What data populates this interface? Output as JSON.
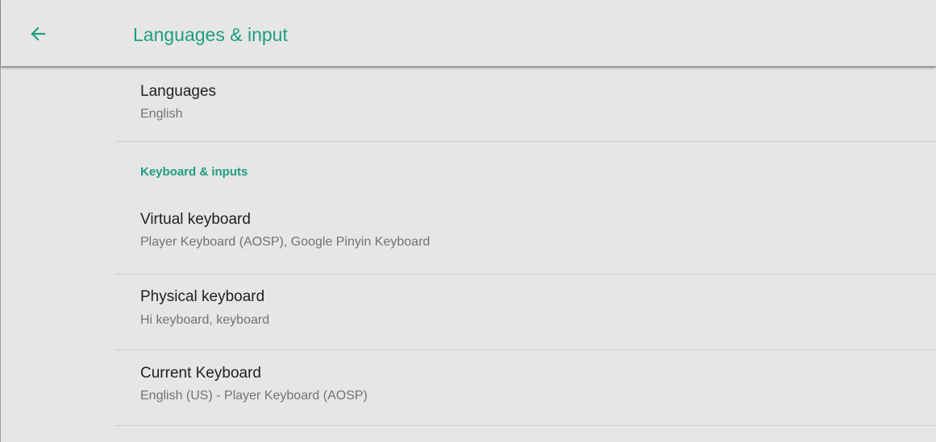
{
  "colors": {
    "accent": "#1e9e7e",
    "background": "#e6e6e6",
    "divider": "#cfcfcf",
    "primary_text": "#212121",
    "secondary_text": "#737373"
  },
  "app_bar": {
    "back_icon": "arrow-left-icon",
    "title": "Languages & input"
  },
  "settings": {
    "languages": {
      "title": "Languages",
      "summary": "English"
    },
    "keyboard_category": "Keyboard & inputs",
    "virtual_keyboard": {
      "title": "Virtual keyboard",
      "summary": "Player Keyboard (AOSP), Google Pinyin Keyboard"
    },
    "physical_keyboard": {
      "title": "Physical keyboard",
      "summary": "Hi keyboard, keyboard"
    },
    "current_keyboard": {
      "title": "Current Keyboard",
      "summary": "English (US) - Player Keyboard (AOSP)"
    }
  }
}
